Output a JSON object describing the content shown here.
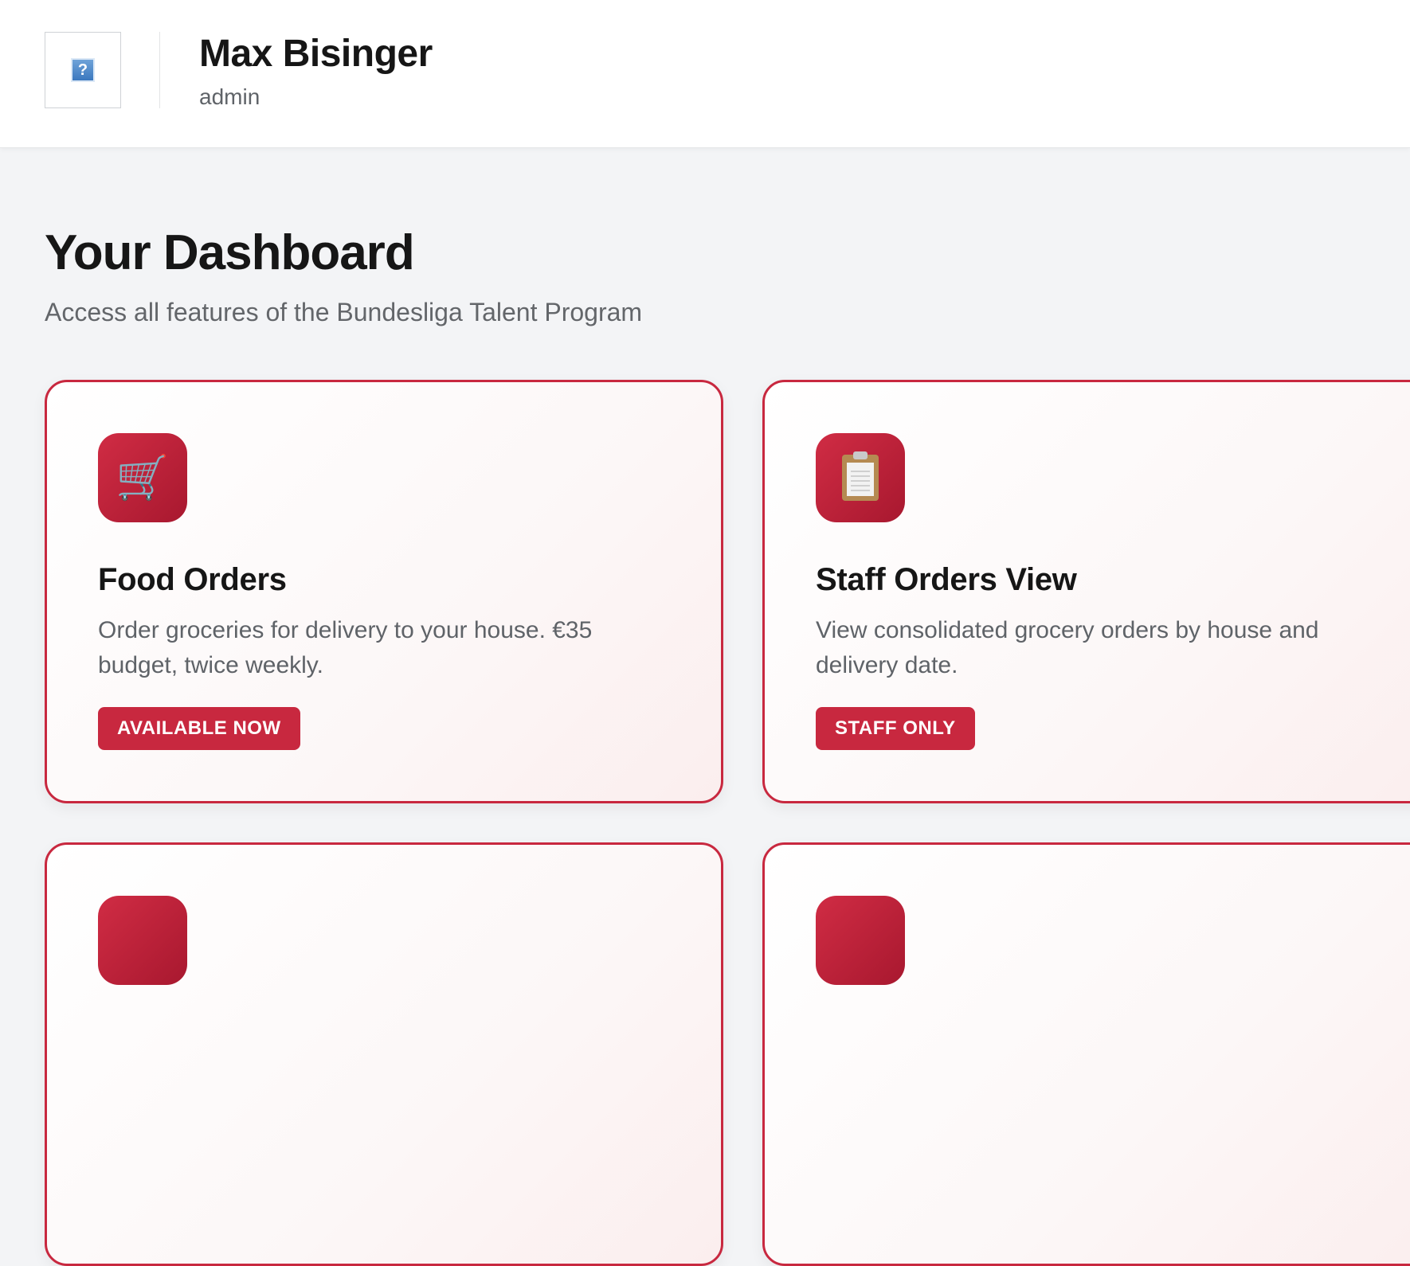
{
  "header": {
    "avatar_glyph": "?",
    "user_name": "Max Bisinger",
    "user_role": "admin"
  },
  "main": {
    "title": "Your Dashboard",
    "subtitle": "Access all features of the Bundesliga Talent Program"
  },
  "cards": [
    {
      "icon": "shopping-cart-icon",
      "icon_glyph": "🛒",
      "title": "Food Orders",
      "description": "Order groceries for delivery to your house. €35 budget, twice weekly.",
      "badge": "AVAILABLE NOW"
    },
    {
      "icon": "clipboard-icon",
      "title": "Staff Orders View",
      "description": "View consolidated grocery orders by house and delivery date.",
      "badge": "STAFF ONLY"
    }
  ],
  "colors": {
    "accent": "#c8283f",
    "icon_bg": "#b81f37",
    "page_bg": "#f3f4f6"
  }
}
